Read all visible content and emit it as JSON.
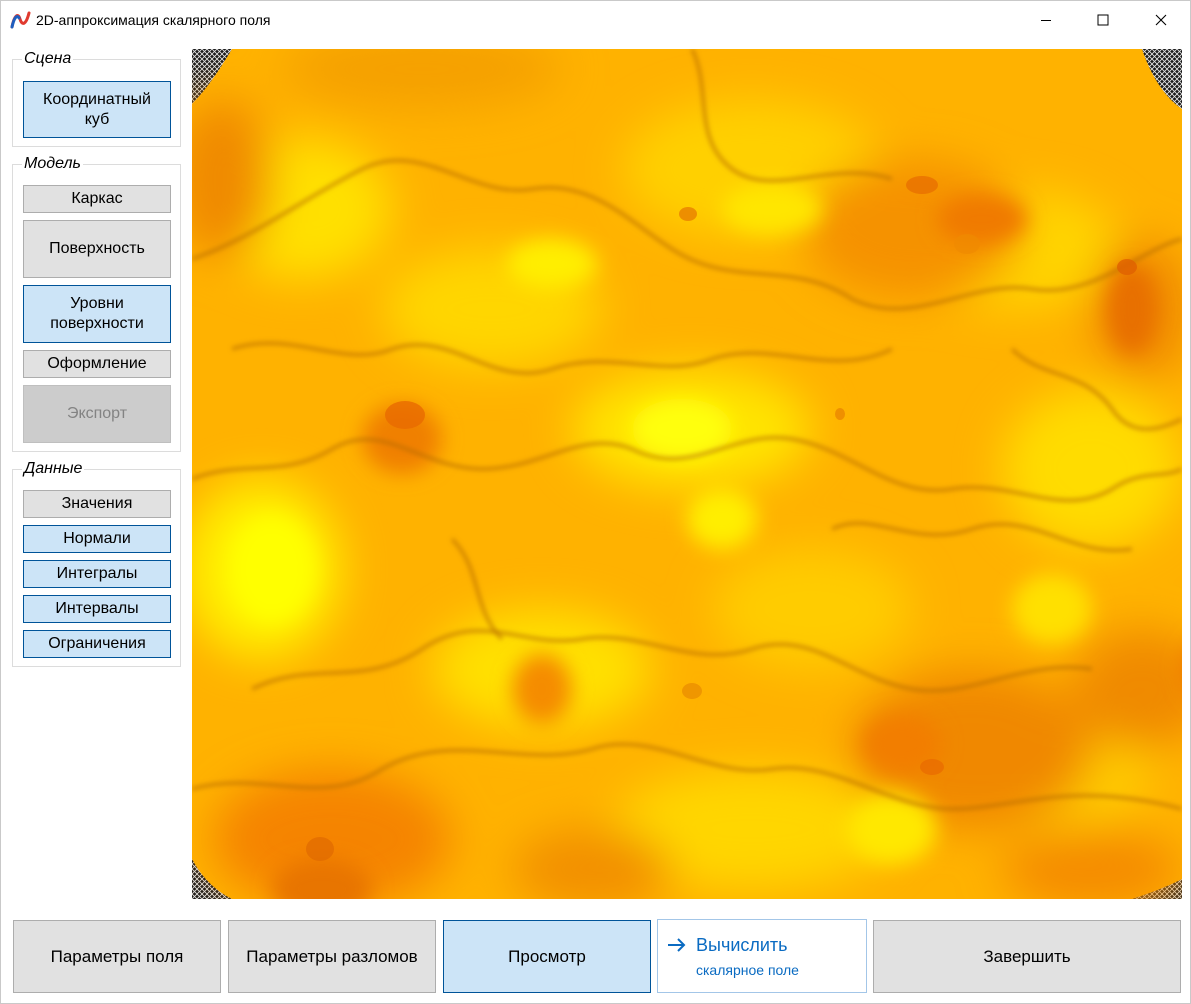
{
  "window": {
    "title": "2D-аппроксимация скалярного поля"
  },
  "scene_group": {
    "label": "Сцена",
    "cube_button": [
      "Координатный",
      "куб"
    ]
  },
  "model_group": {
    "label": "Модель",
    "frame_button": "Каркас",
    "surface_button": "Поверхность",
    "levels_button": [
      "Уровни",
      "поверхности"
    ],
    "design_button": "Оформление",
    "export_button": "Экспорт"
  },
  "data_group": {
    "label": "Данные",
    "values_button": "Значения",
    "normals_button": "Нормали",
    "integrals_button": "Интегралы",
    "intervals_button": "Интервалы",
    "constraints_button": "Ограничения"
  },
  "footer": {
    "field_params_button": "Параметры поля",
    "fault_params_button": "Параметры разломов",
    "preview_button": "Просмотр",
    "compute_button": {
      "main": "Вычислить",
      "sub": "скалярное поле",
      "icon": "arrow-right-icon"
    },
    "finish_button": "Завершить"
  },
  "colors": {
    "accent_blue": "#0a6bc2",
    "button_active": "#cce4f7",
    "surface_light": "#ffe600",
    "surface_mid": "#ffb400",
    "surface_dark": "#f07800"
  }
}
